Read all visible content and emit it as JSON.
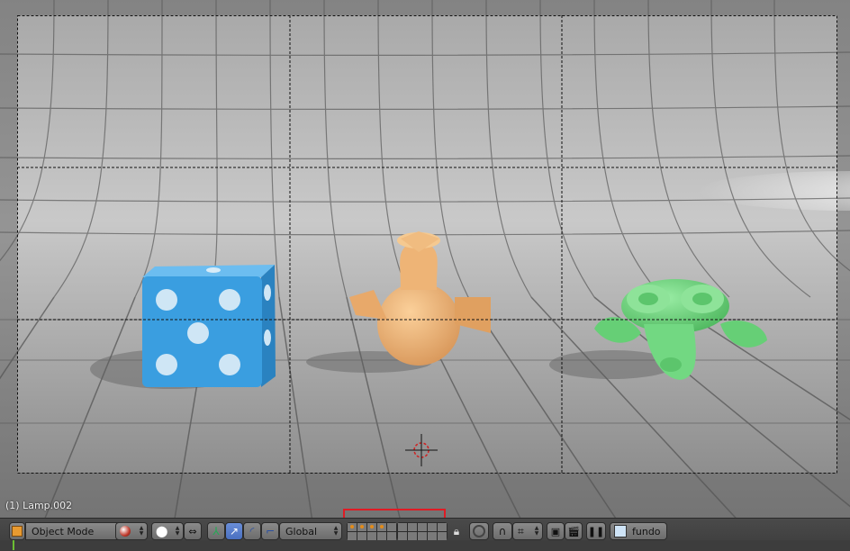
{
  "viewport": {
    "active_object_label": "(1) Lamp.002",
    "objects": [
      "dice",
      "gourd",
      "monkey"
    ],
    "colors": {
      "backdrop": "#c4c4c4",
      "floor": "#b8b8b8",
      "dice": "#3a9ee0",
      "gourd": "#f0b878",
      "monkey": "#6fd67f"
    }
  },
  "header": {
    "editor_type_icon": "cube-icon",
    "mode": "Object Mode",
    "viewport_shading_icon": "sphere-shading-icon",
    "pivot_icon": "pivot-point-icon",
    "manipulator_icons": [
      "manipulator-toggle-icon",
      "translate-icon",
      "rotate-icon",
      "scale-icon"
    ],
    "orientation": "Global",
    "layers_group_1": [
      true,
      true,
      true,
      true,
      false,
      false,
      false,
      false,
      false,
      false
    ],
    "layers_group_2": [
      false,
      false,
      false,
      false,
      false,
      false,
      false,
      false,
      false,
      false
    ],
    "lock_icon": "lock-icon",
    "proportional_icon": "proportional-edit-icon",
    "snap_icon": "magnet-icon",
    "snap_element_icon": "snap-element-icon",
    "render_icons": [
      "render-image-icon",
      "render-animation-icon"
    ],
    "camera_icon": "camera-icon",
    "scene_icon": "scene-icon",
    "scene_name": "fundo"
  }
}
